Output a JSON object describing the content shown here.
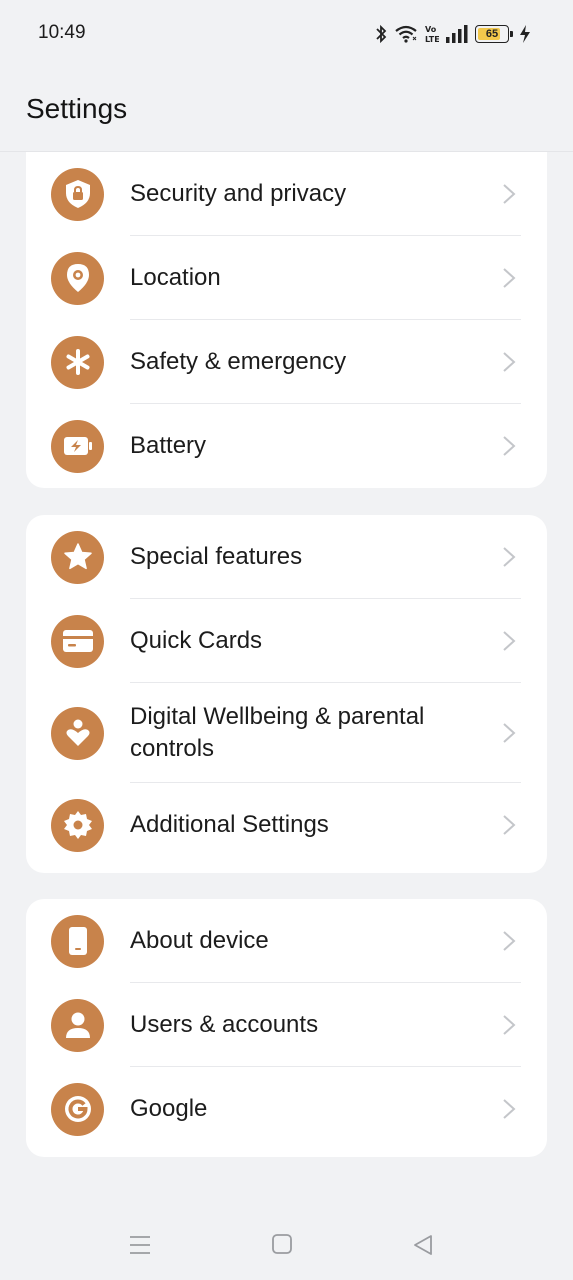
{
  "status_bar": {
    "time": "10:49",
    "battery_level": "65",
    "icons": [
      "bluetooth-icon",
      "wifi-icon",
      "volte-icon",
      "signal-icon",
      "battery-icon",
      "charging-icon"
    ]
  },
  "header": {
    "title": "Settings"
  },
  "colors": {
    "accent": "#c8834b",
    "background": "#f1f2f4",
    "card": "#ffffff"
  },
  "groups": [
    {
      "items": [
        {
          "label": "Security and privacy",
          "icon": "shield-lock-icon"
        },
        {
          "label": "Location",
          "icon": "location-pin-icon"
        },
        {
          "label": "Safety & emergency",
          "icon": "asterisk-icon"
        },
        {
          "label": "Battery",
          "icon": "battery-charging-icon"
        }
      ]
    },
    {
      "items": [
        {
          "label": "Special features",
          "icon": "star-icon"
        },
        {
          "label": "Quick Cards",
          "icon": "card-icon"
        },
        {
          "label": "Digital Wellbeing & parental controls",
          "icon": "heart-person-icon"
        },
        {
          "label": "Additional Settings",
          "icon": "gear-icon"
        }
      ]
    },
    {
      "items": [
        {
          "label": "About device",
          "icon": "phone-device-icon"
        },
        {
          "label": "Users & accounts",
          "icon": "user-icon"
        },
        {
          "label": "Google",
          "icon": "google-icon"
        }
      ]
    }
  ],
  "nav_bar": {
    "buttons": [
      "menu-icon",
      "home-icon",
      "back-icon"
    ]
  }
}
